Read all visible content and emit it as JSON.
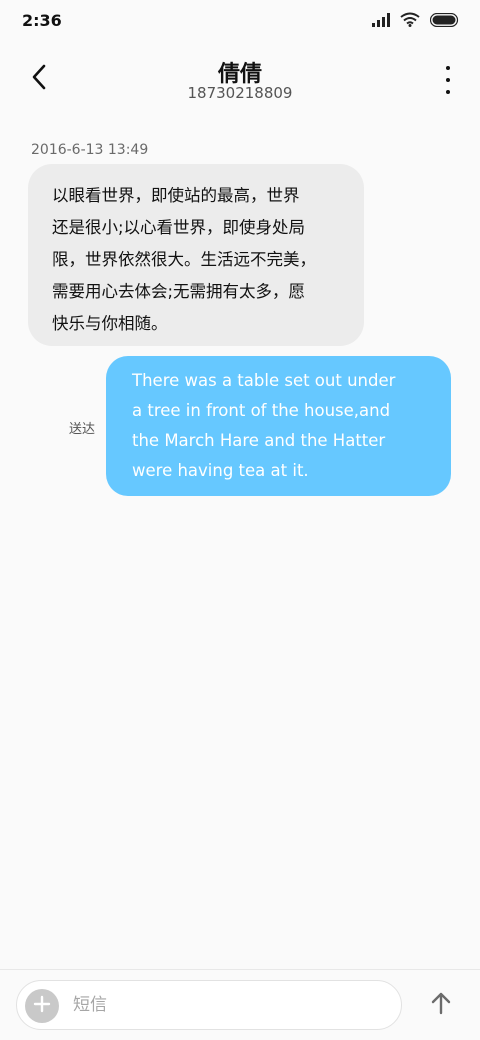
{
  "status_bar": {
    "time": "2:36",
    "icons": [
      "signal-icon",
      "wifi-icon",
      "battery-icon"
    ]
  },
  "header": {
    "contact_name": "倩倩",
    "phone_number": "18730218809",
    "back_icon": "chevron-left-icon",
    "more_icon": "more-vertical-icon"
  },
  "conversation": {
    "timestamp": "2016-6-13 13:49",
    "incoming_message": {
      "lines": [
        "以眼看世界，即使站的最高，世界",
        "还是很小;以心看世界，即使身处局",
        "限，世界依然很大。生活远不完美，",
        "需要用心去体会;无需拥有太多，愿",
        "快乐与你相随。"
      ]
    },
    "outgoing_message": {
      "lines": [
        "There was a table set out under",
        "a tree in front of the house,and",
        "the March Hare and the Hatter",
        "were having tea at it."
      ],
      "status": "送达"
    }
  },
  "composer": {
    "placeholder": "短信",
    "add_icon": "plus-icon",
    "send_icon": "arrow-up-icon"
  },
  "colors": {
    "incoming_bubble": "#ececec",
    "outgoing_bubble": "#66c8ff",
    "background": "#fafafa"
  }
}
